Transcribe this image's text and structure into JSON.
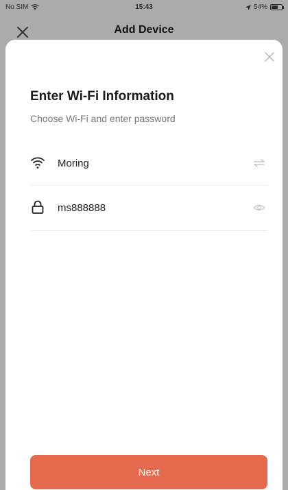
{
  "status_bar": {
    "carrier": "No SIM",
    "time": "15:43",
    "battery": "54%",
    "battery_level": 0.54
  },
  "nav": {
    "title": "Add Device"
  },
  "form": {
    "heading": "Enter Wi-Fi Information",
    "subheading": "Choose Wi-Fi and enter password",
    "wifi_name": "Moring",
    "password": "ms888888"
  },
  "actions": {
    "next_label": "Next"
  },
  "colors": {
    "accent": "#e5694c",
    "backdrop": "#ababab"
  },
  "icons": {
    "wifi_field": "wifi-icon",
    "password_field": "lock-icon",
    "switch_network": "swap-icon",
    "toggle_visibility": "eye-icon"
  }
}
